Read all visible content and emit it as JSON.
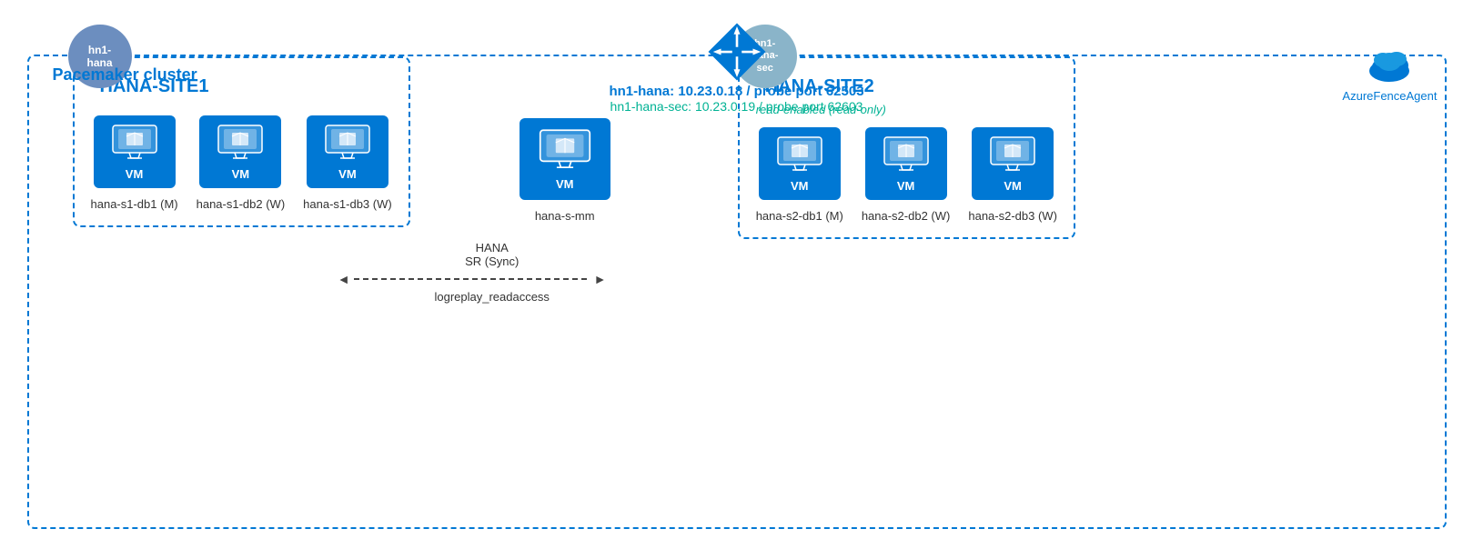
{
  "diagram": {
    "title": "Pacemaker cluster",
    "router_icon": "router",
    "lb_primary": "hn1-hana:  10.23.0.18 / probe port 62503",
    "lb_secondary": "hn1-hana-sec:  10.23.0.19 / probe port 62603",
    "fence_agent_label": "AzureFenceAgent",
    "site1": {
      "title": "HANA-SITE1",
      "node_label": "hn1-\nhana",
      "nodes": [
        {
          "name": "hana-s1-db1 (M)"
        },
        {
          "name": "hana-s1-db2 (W)"
        },
        {
          "name": "hana-s1-db3 (W)"
        }
      ]
    },
    "site2": {
      "title": "HANA-SITE2",
      "node_label": "hn1-\nhana-\nsec",
      "read_enabled": "read-enabled (read-only)",
      "nodes": [
        {
          "name": "hana-s2-db1 (M)"
        },
        {
          "name": "hana-s2-db2 (W)"
        },
        {
          "name": "hana-s2-db3 (W)"
        }
      ]
    },
    "middle_node": {
      "name": "hana-s-mm"
    },
    "sync": {
      "label1": "HANA",
      "label2": "SR (Sync)",
      "label3": "logreplay_readaccess"
    }
  }
}
